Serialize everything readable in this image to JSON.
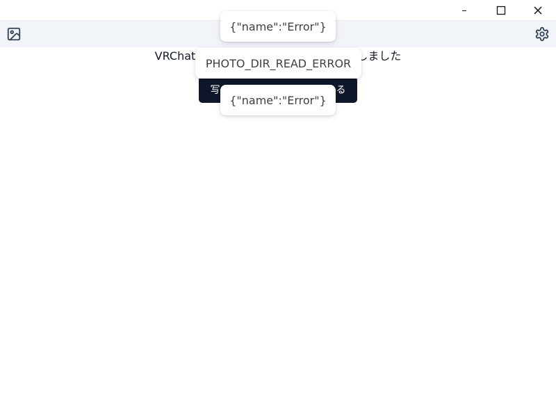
{
  "window_controls": {
    "minimize_icon": "minimize-icon",
    "maximize_icon": "maximize-icon",
    "close_icon": "close-icon"
  },
  "toolbar": {
    "gallery_icon": "image-icon",
    "settings_icon": "gear-icon"
  },
  "main": {
    "error_message_prefix": "VRChat",
    "error_message_suffix": "しました",
    "button_label_prefix": "写",
    "button_label_suffix": "る"
  },
  "toasts": [
    {
      "message": "{\"name\":\"Error\"}"
    },
    {
      "message": "PHOTO_DIR_READ_ERROR"
    },
    {
      "message": "{\"name\":\"Error\"}"
    }
  ],
  "colors": {
    "toolbar_bg": "#f1f4f9",
    "button_bg": "#0f172a",
    "button_text": "#ffffff",
    "icon": "#334155"
  }
}
